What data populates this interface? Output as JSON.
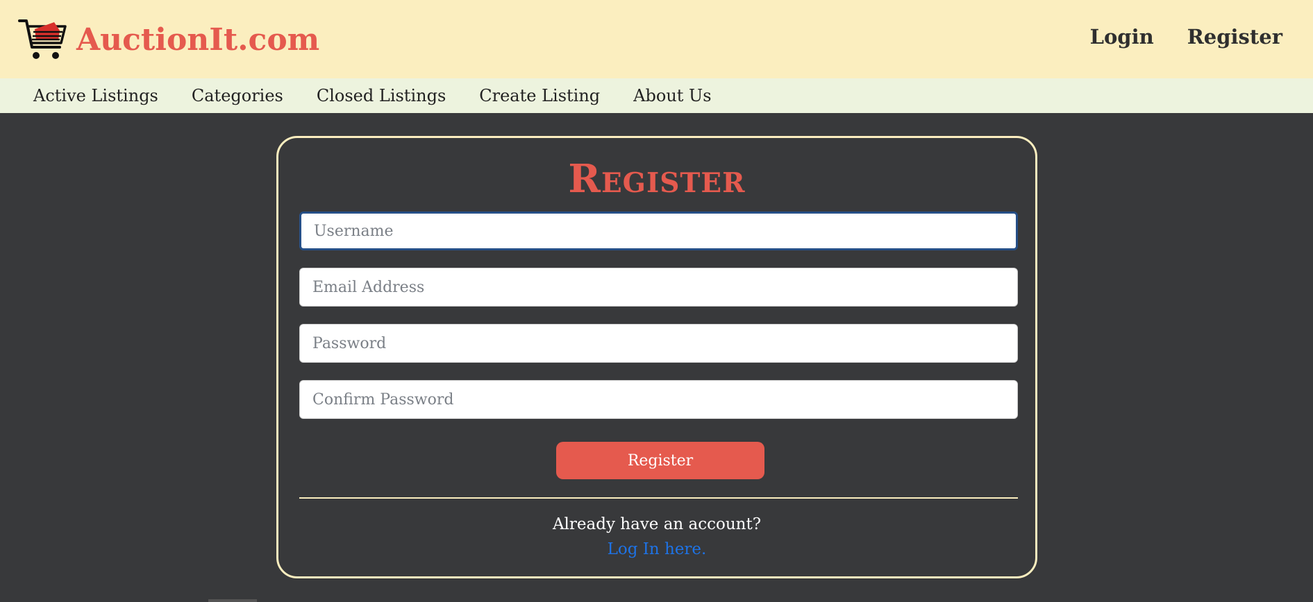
{
  "brand": {
    "name": "AuctionIt.com",
    "logo_icon": "shopping-cart-icon"
  },
  "auth_nav": {
    "login": "Login",
    "register": "Register"
  },
  "main_nav": [
    "Active Listings",
    "Categories",
    "Closed Listings",
    "Create Listing",
    "About Us"
  ],
  "form": {
    "title": "Register",
    "username_placeholder": "Username",
    "email_placeholder": "Email Address",
    "password_placeholder": "Password",
    "confirm_placeholder": "Confirm Password",
    "submit_label": "Register",
    "already_text": "Already have an account?",
    "login_link": "Log In here."
  },
  "colors": {
    "header_bg": "#fbeebf",
    "nav_bg": "#edf3de",
    "page_bg": "#38393b",
    "accent": "#e55a4e",
    "link": "#1e73e6"
  }
}
